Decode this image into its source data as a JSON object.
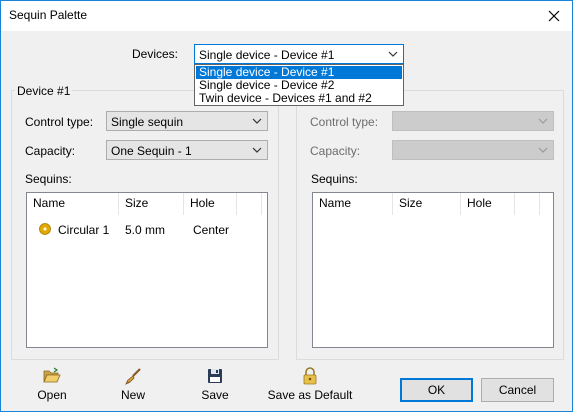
{
  "window": {
    "title": "Sequin Palette"
  },
  "devices": {
    "label": "Devices:",
    "selected": "Single device - Device #1",
    "options": [
      "Single device - Device #1",
      "Single device - Device #2",
      "Twin device - Devices #1 and #2"
    ]
  },
  "left": {
    "group_title": "Device #1",
    "control_type_label": "Control type:",
    "control_type_value": "Single sequin",
    "capacity_label": "Capacity:",
    "capacity_value": "One Sequin - 1",
    "sequins_label": "Sequins:",
    "columns": [
      "Name",
      "Size",
      "Hole"
    ],
    "rows": [
      {
        "name": "Circular 1",
        "size": "5.0 mm",
        "hole": "Center"
      }
    ]
  },
  "right": {
    "control_type_label": "Control type:",
    "capacity_label": "Capacity:",
    "sequins_label": "Sequins:",
    "columns": [
      "Name",
      "Size",
      "Hole"
    ]
  },
  "toolbar": {
    "open": "Open",
    "new": "New",
    "save": "Save",
    "save_default": "Save as Default"
  },
  "buttons": {
    "ok": "OK",
    "cancel": "Cancel"
  },
  "colors": {
    "accent": "#0078d7",
    "sequin": "#e0a800"
  },
  "icons": [
    "close-icon",
    "chevron-down-icon",
    "sequin-icon",
    "folder-open-icon",
    "brush-icon",
    "floppy-disk-icon",
    "lock-icon"
  ]
}
